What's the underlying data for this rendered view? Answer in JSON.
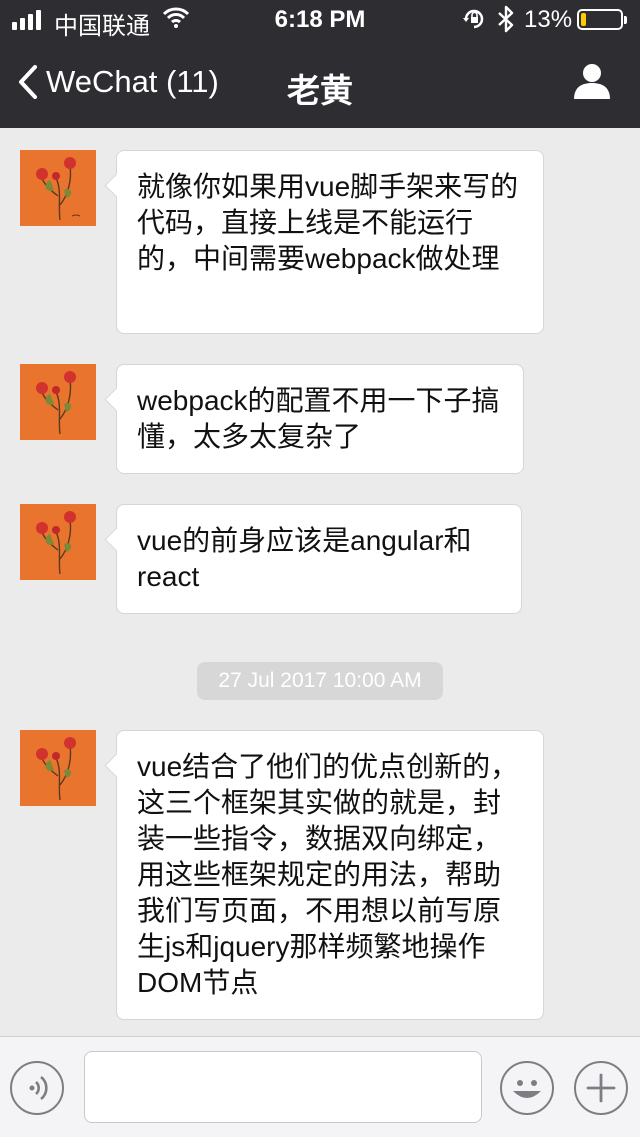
{
  "status_bar": {
    "carrier": "中国联通",
    "time": "6:18 PM",
    "battery_percent": "13%",
    "battery_level": 0.13,
    "signal_bars": 4,
    "icons": [
      "signal-icon",
      "wifi-icon",
      "orientation-lock-icon",
      "bluetooth-icon",
      "battery-icon"
    ]
  },
  "nav": {
    "back_label": "WeChat (11)",
    "title": "老黄",
    "icons": [
      "chevron-left-icon",
      "profile-icon"
    ]
  },
  "messages": [
    {
      "sender": "other",
      "text": "就像你如果用vue脚手架来写的代码，直接上线是不能运行的，中间需要webpack做处理"
    },
    {
      "sender": "other",
      "text": "webpack的配置不用一下子搞懂，太多太复杂了"
    },
    {
      "sender": "other",
      "text": "vue的前身应该是angular和react"
    },
    {
      "sender": "other",
      "text": "vue结合了他们的优点创新的，这三个框架其实做的就是，封装一些指令，数据双向绑定，用这些框架规定的用法，帮助我们写页面，不用想以前写原生js和jquery那样频繁地操作DOM节点"
    }
  ],
  "timestamp": "27 Jul 2017 10:00 AM",
  "input_bar": {
    "value": "",
    "icons": [
      "voice-icon",
      "emoji-icon",
      "plus-icon"
    ]
  },
  "colors": {
    "header_bg": "#2e2e32",
    "chat_bg": "#ebebeb",
    "bubble_bg": "#ffffff",
    "avatar_bg": "#e9742d",
    "battery_fill": "#ffcc00"
  }
}
